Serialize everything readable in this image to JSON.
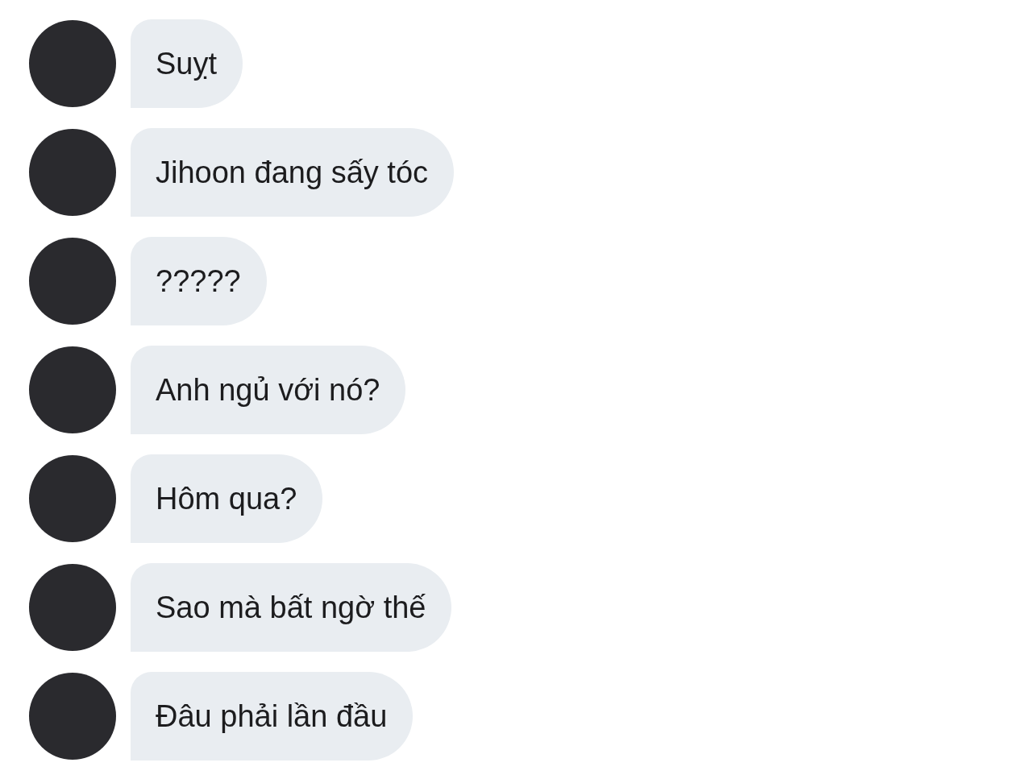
{
  "messages": [
    {
      "text": "Suỵt"
    },
    {
      "text": "Jihoon đang sấy tóc"
    },
    {
      "text": "?????"
    },
    {
      "text": "Anh ngủ với nó?"
    },
    {
      "text": "Hôm qua?"
    },
    {
      "text": "Sao mà bất ngờ thế"
    },
    {
      "text": "Đâu phải lần đầu"
    }
  ]
}
